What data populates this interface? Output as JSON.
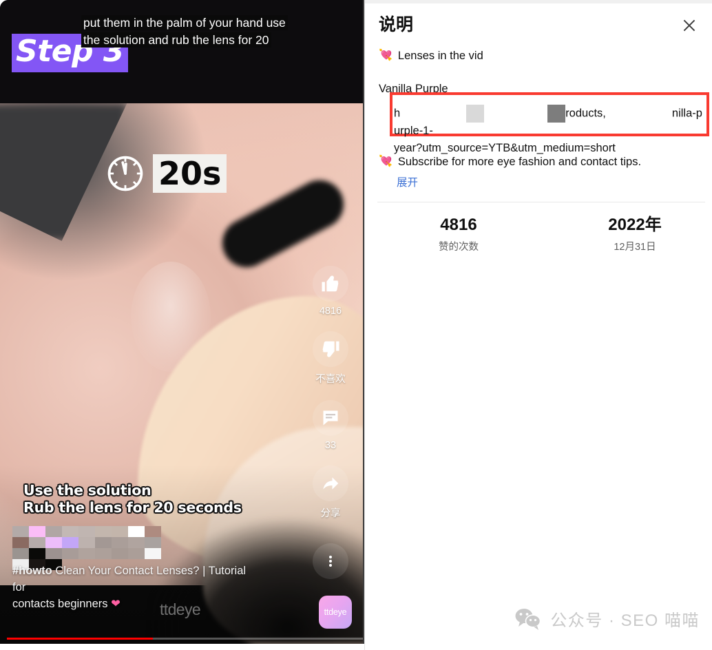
{
  "video": {
    "step_badge": "Step 3",
    "caption_line1": "put them in the palm of your hand use",
    "caption_line2": "the solution and rub the lens for 20",
    "timer_label": "20s",
    "clock_icon": "clock-icon",
    "sub_caption_line1": "Use the solution",
    "sub_caption_line2": "Rub the lens for 20 seconds",
    "title_hashtag": "#howto",
    "title_rest": " Clean Your Contact Lenses? | Tutorial for",
    "title_line2": "contacts beginners ",
    "title_heart": "❤",
    "watermark": "ttdeye",
    "brand_tile": "ttdeye",
    "progress_percent": 41,
    "actions": [
      {
        "icon": "thumbs-up-icon",
        "label": "4816"
      },
      {
        "icon": "thumbs-down-icon",
        "label": "不喜欢"
      },
      {
        "icon": "comment-icon",
        "label": "33"
      },
      {
        "icon": "share-icon",
        "label": "分享"
      }
    ],
    "more_icon": "kebab-menu-icon"
  },
  "panel": {
    "title": "说明",
    "close_icon": "close-icon",
    "line1": "Lenses in the vid",
    "line_hidden": "Vanilla Purple",
    "url_part1": "h",
    "url_part2": "roducts,",
    "url_part3": "nilla-purple-1-",
    "url_part4": "year?utm_source=YTB&utm_medium=short",
    "line2": "Subscribe for more eye fashion and contact tips.",
    "expand_label": "展开",
    "heart_icon": "heart-icon",
    "highlight_color": "#f93a30",
    "link_color": "#3b6fd4",
    "stats": [
      {
        "value": "4816",
        "caption": "赞的次数"
      },
      {
        "value": "2022年",
        "caption": "12月31日"
      }
    ]
  },
  "watermark": {
    "icon": "wechat-icon",
    "text": "公众号 · SEO 喵喵"
  }
}
